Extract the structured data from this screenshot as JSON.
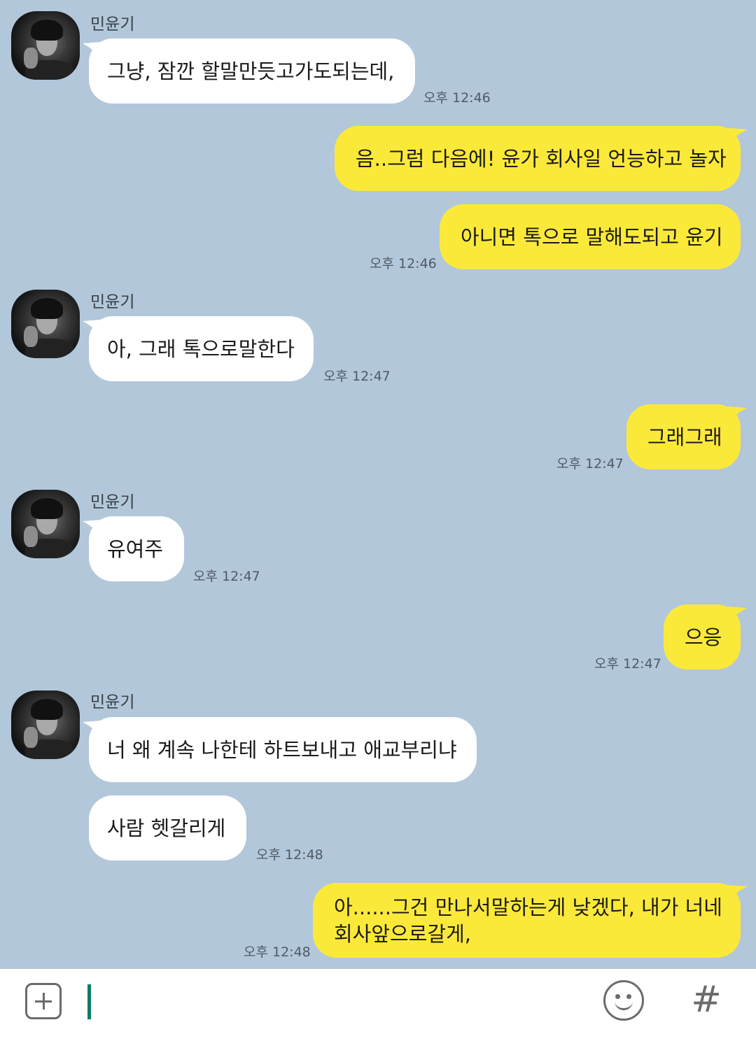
{
  "chat": {
    "sender_name": "민윤기",
    "messages": [
      {
        "text": "그냥, 잠깐 할말만듯고가도되는데,",
        "time": "오후 12:46"
      },
      {
        "text": "음..그럼 다음에! 윤가 회사일 언능하고 놀자"
      },
      {
        "text": "아니면 톡으로 말해도되고 윤기",
        "time": "오후 12:46"
      },
      {
        "text": "아, 그래 톡으로말한다",
        "time": "오후 12:47"
      },
      {
        "text": "그래그래",
        "time": "오후 12:47"
      },
      {
        "text": "유여주",
        "time": "오후 12:47"
      },
      {
        "text": "으응",
        "time": "오후 12:47"
      },
      {
        "text": "너 왜 계속 나한테 하트보내고 애교부리냐"
      },
      {
        "text": "사람 헷갈리게",
        "time": "오후 12:48"
      },
      {
        "text_line1": "아......그건 만나서말하는게 낮겠다, 내가 너네",
        "text_line2": "회사앞으로갈게,",
        "time": "오후 12:48"
      }
    ]
  },
  "input_bar": {
    "plus_icon": "plus-square-icon",
    "input_value": "",
    "emoji_icon": "smiley-icon",
    "hash_label": "#"
  },
  "colors": {
    "background": "#b2c7da",
    "incoming_bubble": "#ffffff",
    "outgoing_bubble": "#fbe93a",
    "caret": "#0b7e66"
  }
}
